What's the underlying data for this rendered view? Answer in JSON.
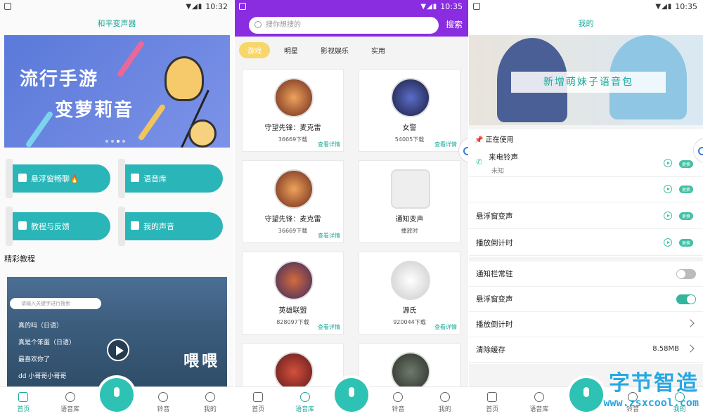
{
  "status": {
    "time1": "10:32",
    "time2": "10:35",
    "time3": "10:35"
  },
  "colors": {
    "accent": "#1aa89a",
    "purple": "#8a2ce0",
    "yellow_tab": "#f7d66b",
    "teal_tile": "#2ab6b8"
  },
  "screen1": {
    "title": "和平变声器",
    "banner": {
      "line1": "流行手游",
      "line2": "变萝莉音"
    },
    "tiles": [
      {
        "label": "悬浮窗畅聊🔥",
        "icon": "thumb-icon"
      },
      {
        "label": "语音库",
        "icon": "note-icon"
      },
      {
        "label": "教程与反馈",
        "icon": "book-icon"
      },
      {
        "label": "我的声音",
        "icon": "puzzle-icon"
      }
    ],
    "section_title": "精彩教程",
    "video": {
      "search_placeholder": "请输入关键字进行搜索",
      "items": [
        "真的吗（日语）",
        "真是个笨蛋（日语）",
        "最喜欢你了",
        "dd 小哥哥小哥哥"
      ],
      "overlay_text": "喂喂"
    }
  },
  "screen2": {
    "search_placeholder": "搜你想搜的",
    "search_button": "搜索",
    "tabs": [
      "游戏",
      "明星",
      "影视娱乐",
      "实用"
    ],
    "cards": [
      {
        "name": "守望先锋：麦克雷",
        "downloads": "36669下载",
        "more": "查看详情"
      },
      {
        "name": "女警",
        "downloads": "54005下载",
        "more": "查看详情"
      },
      {
        "name": "守望先锋：麦克雷",
        "downloads": "36669下载",
        "more": "查看详情"
      },
      {
        "name": "通知变声",
        "downloads": "播放时",
        "more": ""
      },
      {
        "name": "英雄联盟",
        "downloads": "828097下载",
        "more": "查看详情"
      },
      {
        "name": "源氏",
        "downloads": "920044下载",
        "more": "查看详情"
      }
    ]
  },
  "screen3": {
    "title": "我的",
    "banner_text": "新增萌妹子语音包",
    "in_use_label": "正在使用",
    "ringtone": {
      "label": "来电铃声",
      "sub": "未知",
      "chip": "更换"
    },
    "rows_in_use": [
      {
        "label": "",
        "chip": "更换"
      },
      {
        "label": "悬浮窗变声",
        "chip": "更换"
      },
      {
        "label": "播放倒计时",
        "chip": "更换"
      }
    ],
    "settings": [
      {
        "label": "通知栏常驻",
        "type": "toggle",
        "on": false
      },
      {
        "label": "悬浮窗变声",
        "type": "toggle",
        "on": true
      },
      {
        "label": "播放倒计时",
        "type": "chevron"
      },
      {
        "label": "清除缓存",
        "type": "value",
        "value": "8.58MB"
      }
    ],
    "watermark": {
      "line1": "字节智造",
      "line2": "www.zsxcool.com"
    }
  },
  "nav": [
    {
      "label": "首页",
      "icon": "home-icon"
    },
    {
      "label": "语音库",
      "icon": "disc-icon"
    },
    {
      "label": "",
      "icon": "mic-icon"
    },
    {
      "label": "铃音",
      "icon": "bell-icon"
    },
    {
      "label": "我的",
      "icon": "user-icon"
    }
  ]
}
